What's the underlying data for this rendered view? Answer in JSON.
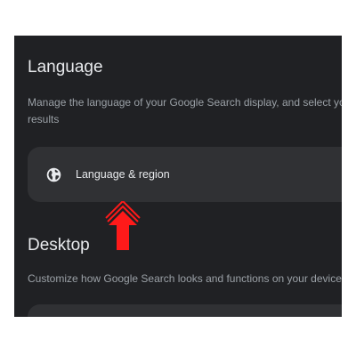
{
  "language_section": {
    "title": "Language",
    "description": "Manage the language of your Google Search display, and select your results",
    "card": {
      "label": "Language & region",
      "icon": "globe-icon"
    }
  },
  "desktop_section": {
    "title": "Desktop",
    "description": "Customize how Google Search looks and functions on your device"
  },
  "colors": {
    "background": "#202124",
    "card": "#303134",
    "title_text": "#e8eaed",
    "description_text": "#9aa0a6",
    "annotation_arrow": "#ff1a1a"
  }
}
